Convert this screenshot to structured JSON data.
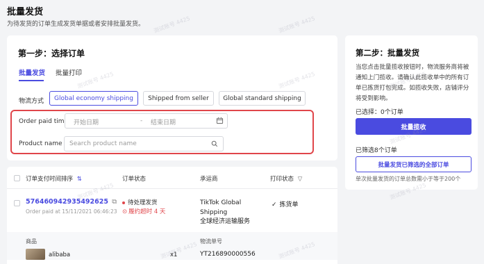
{
  "header": {
    "title": "批量发货",
    "subtitle": "为待发货的订单生成发货单据或者安排批量发货。"
  },
  "step1": {
    "title": "第一步：选择订单",
    "tabs": [
      {
        "label": "批量发货",
        "active": true
      },
      {
        "label": "批量打印",
        "active": false
      }
    ],
    "shipping_label": "物流方式",
    "shipping_options": [
      {
        "label": "Global economy shipping",
        "active": true
      },
      {
        "label": "Shipped from seller",
        "active": false
      },
      {
        "label": "Global standard shipping",
        "active": false
      }
    ],
    "order_paid_time_label": "Order paid time",
    "start_date_placeholder": "开始日期",
    "date_separator": "-",
    "end_date_placeholder": "结束日期",
    "product_name_label": "Product name",
    "product_search_placeholder": "Search product name"
  },
  "step2": {
    "title": "第二步：批量发货",
    "description": "当您点击批量揽收按钮时，物流服务商将被通知上门揽收。请确认此揽收单中的所有订单已拣货打包完成。如揽收失败，店铺评分将受到影响。",
    "selected_label": "已选择：0个订单",
    "batch_pickup_button": "批量揽收",
    "filtered_label": "已筛选8个订单",
    "ship_all_button": "批量发货已筛选的全部订单",
    "note": "单次批量发货的订单总数需小于等于200个"
  },
  "table": {
    "headers": {
      "order_time": "订单支付时间排序",
      "status": "订单状态",
      "carrier": "承运商",
      "print_status": "打印状态"
    },
    "rows": [
      {
        "order_id": "576460942935492625",
        "paid_at": "Order paid at 15/11/2021 06:46:23",
        "status": "待处理发货",
        "overdue": "履约超时 4 天",
        "carrier_line1": "TikTok Global",
        "carrier_line2": "Shipping",
        "carrier_line3": "全球经济运输服务",
        "print_status": "拣货单",
        "goods_header": "商品",
        "tracking_header": "物流单号",
        "goods_name": "alibaba",
        "quantity": "x1",
        "tracking_no": "YT216890000556"
      }
    ]
  },
  "watermark": "测试账号 4425",
  "colors": {
    "accent": "#4a4be0",
    "danger": "#e0454a",
    "page_bg": "#f3f4f6"
  }
}
